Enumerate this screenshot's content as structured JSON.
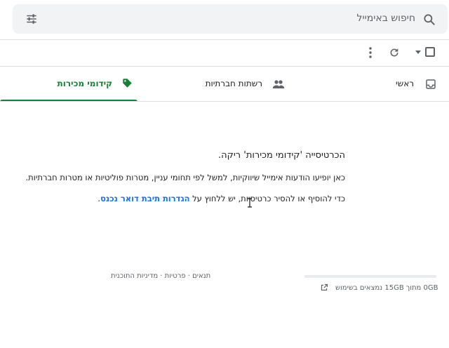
{
  "search": {
    "placeholder": "חיפוש באימייל"
  },
  "tabs": [
    {
      "label": "ראשי"
    },
    {
      "label": "רשתות חברתיות"
    },
    {
      "label": "קידומי מכירות"
    }
  ],
  "active_tab_color": "#188038",
  "empty": {
    "title": "הכרטיסייה 'קידומי מכירות' ריקה.",
    "line2": "כאן יופיעו הודעות אימייל שיווקיות, למשל לפי תחומי עניין, מטרות פוליטיות או מטרות חברתיות.",
    "line3_prefix": "כדי להוסיף או להסיר כרטיסיות, יש ללחוץ על ",
    "line3_link": "הגדרות תיבת דואר נכנס",
    "line3_suffix": "."
  },
  "footer": {
    "links": "תנאים · פרטיות · מדיניות התוכנית",
    "storage": "0GB מתוך 15GB נמצאים בשימוש",
    "storage_used_fraction": 0
  },
  "icons": {
    "search": "search-icon",
    "filter": "tune-icon",
    "refresh": "refresh-icon",
    "more": "more-vert-icon",
    "inbox": "inbox-icon",
    "people": "people-icon",
    "tag": "tag-icon",
    "open": "open-in-new-icon"
  }
}
